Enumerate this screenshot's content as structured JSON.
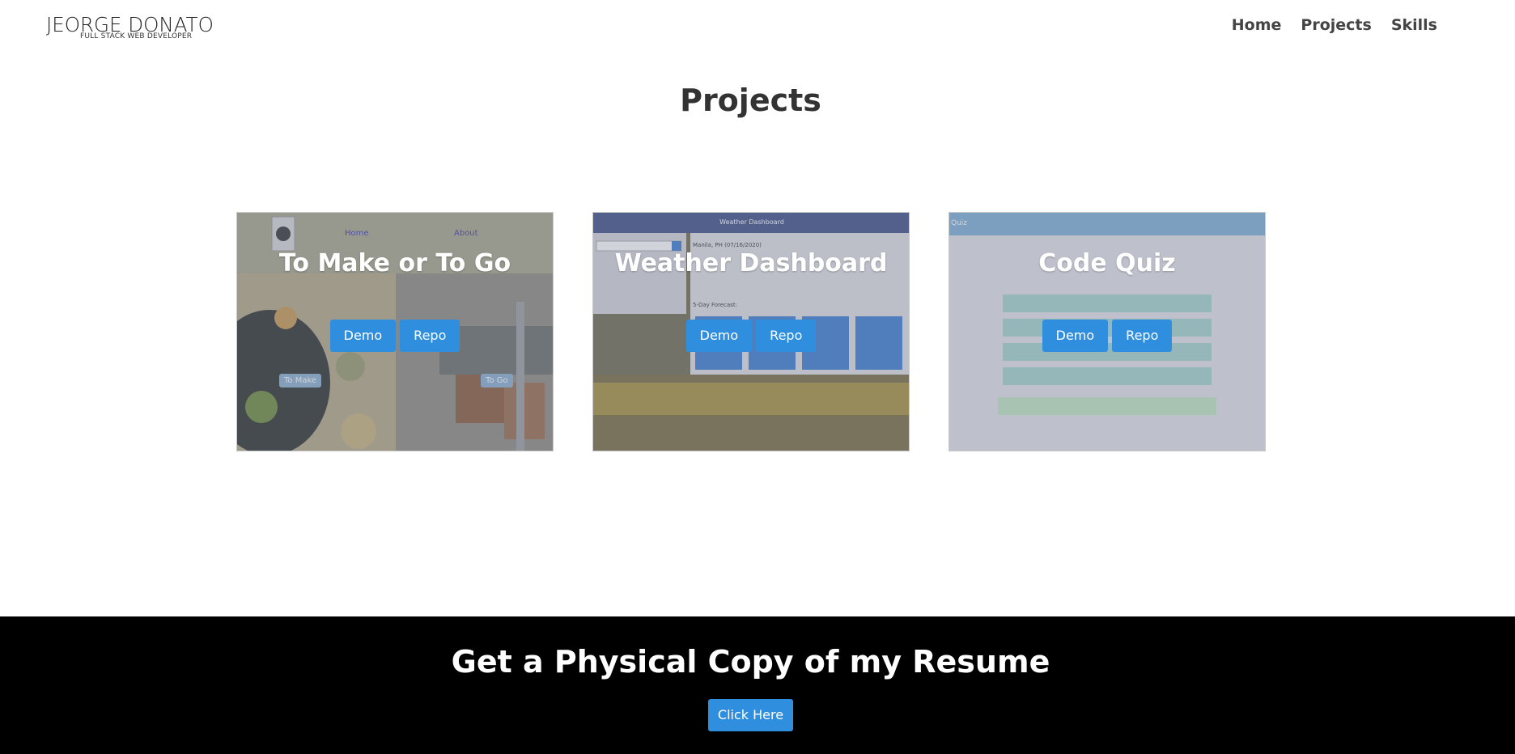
{
  "navbar": {
    "logo_name": "JEORGE DONATO",
    "logo_subtitle": "FULL STACK WEB DEVELOPER",
    "links": [
      "Home",
      "Projects",
      "Skills"
    ]
  },
  "projects": {
    "title": "Projects",
    "demo_label": "Demo",
    "repo_label": "Repo",
    "cards": [
      {
        "title": "To Make or To Go",
        "preview": {
          "nav_home": "Home",
          "nav_about": "About",
          "btn_make": "To Make",
          "btn_go": "To Go"
        }
      },
      {
        "title": "Weather Dashboard",
        "preview": {
          "header": "Weather Dashboard",
          "city": "Manila, PH (07/16/2020)",
          "forecast": "5-Day Forecast:"
        }
      },
      {
        "title": "Code Quiz",
        "preview": {
          "header": "Quiz"
        }
      }
    ]
  },
  "footer": {
    "title": "Get a Physical Copy of my Resume",
    "button": "Click Here"
  },
  "colors": {
    "accent": "#2f8fde",
    "footer_bg": "#000000",
    "text": "#333333"
  }
}
